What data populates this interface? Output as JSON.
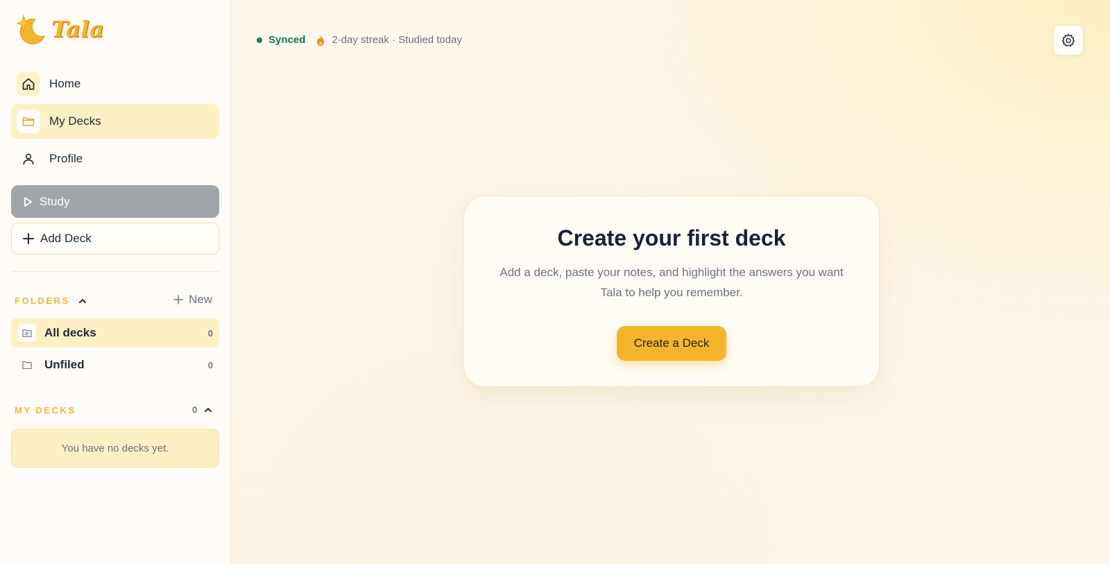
{
  "app": {
    "name": "Tala"
  },
  "nav": {
    "home": "Home",
    "my_decks": "My Decks",
    "profile": "Profile",
    "study": "Study",
    "add_deck": "Add Deck"
  },
  "folders": {
    "title": "FOLDERS",
    "new_label": "New",
    "items": [
      {
        "label": "All decks",
        "count": "0"
      },
      {
        "label": "Unfiled",
        "count": "0"
      }
    ]
  },
  "my_decks": {
    "title": "MY DECKS",
    "count": "0",
    "empty_text": "You have no decks yet."
  },
  "status": {
    "sync": "Synced",
    "streak": "2-day streak · Studied today"
  },
  "card": {
    "title": "Create your first deck",
    "description": "Add a deck, paste your notes, and highlight the answers you want Tala to help you remember.",
    "button": "Create a Deck"
  },
  "colors": {
    "accent": "#f4b52c",
    "section_title": "#f0b632",
    "active_bg": "#fdf0c4",
    "synced": "#17794a",
    "study_disabled": "#a1a5aa"
  },
  "icons": {
    "logo": "moon-star-icon",
    "home": "home-icon",
    "my_decks": "folder-icon",
    "profile": "user-icon",
    "study": "play-icon",
    "add_deck": "plus-icon",
    "folders_toggle": "chevron-up-icon",
    "new_folder": "plus-icon",
    "all_decks": "folder-list-icon",
    "unfiled": "folder-icon",
    "decks_toggle": "chevron-up-icon",
    "streak": "flame-icon",
    "settings": "gear-icon"
  }
}
